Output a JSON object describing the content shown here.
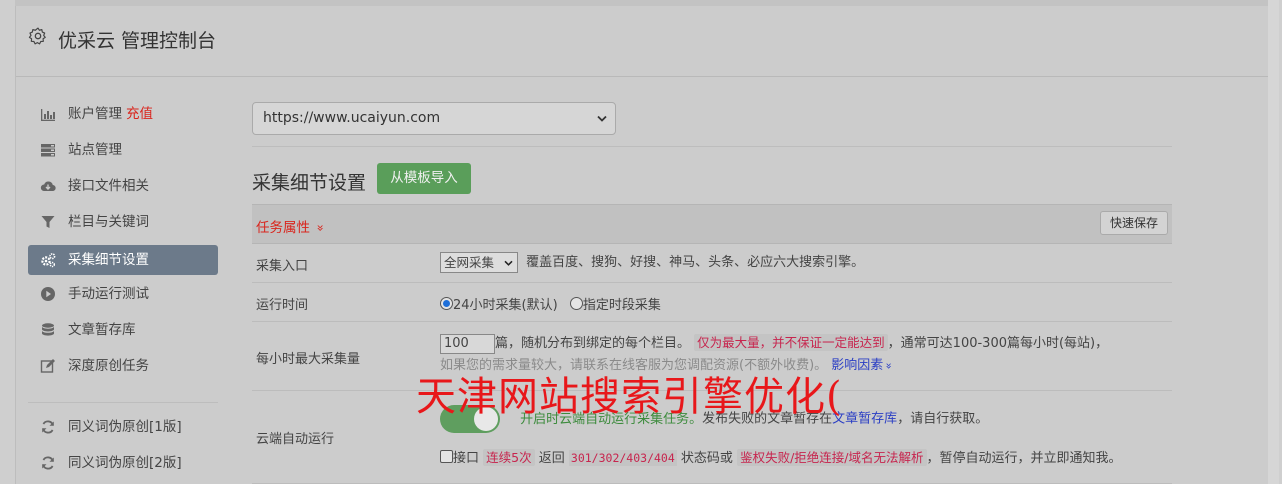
{
  "header": {
    "title": "优采云 管理控制台"
  },
  "sidebar": {
    "items": [
      {
        "label": "账户管理",
        "extra": "充值",
        "icon": "bar-chart-icon"
      },
      {
        "label": "站点管理",
        "icon": "server-icon"
      },
      {
        "label": "接口文件相关",
        "icon": "cloud-download-icon"
      },
      {
        "label": "栏目与关键词",
        "icon": "filter-icon"
      },
      {
        "label": "采集细节设置",
        "icon": "cogs-icon",
        "active": true
      },
      {
        "label": "手动运行测试",
        "icon": "play-circle-icon"
      },
      {
        "label": "文章暂存库",
        "icon": "database-icon"
      },
      {
        "label": "深度原创任务",
        "icon": "edit-icon"
      },
      {
        "label": "同义词伪原创[1版]",
        "icon": "refresh-icon"
      },
      {
        "label": "同义词伪原创[2版]",
        "icon": "refresh-icon"
      }
    ]
  },
  "main": {
    "site_select": {
      "value": "https://www.ucaiyun.com"
    },
    "section_title": "采集细节设置",
    "import_button": "从模板导入",
    "task_attr": "任务属性",
    "task_attr_chevron": "»",
    "quick_save": "快速保存",
    "rows": {
      "entry": {
        "label": "采集入口",
        "select_value": "全网采集",
        "desc": "覆盖百度、搜狗、好搜、神马、头条、必应六大搜索引擎。"
      },
      "time": {
        "label": "运行时间",
        "opt1": "24小时采集(默认)",
        "opt2": "指定时段采集"
      },
      "max": {
        "label": "每小时最大采集量",
        "input_value": "100",
        "text1": "篇，随机分布到绑定的每个栏目。",
        "warn": "仅为最大量，并不保证一定能达到",
        "text2": "，通常可达100-300篇每小时(每站)，",
        "line2_faded": "如果您的需求量较大，请联系在线客服为您调配资源(不额外收费)。",
        "factor_link": "影响因素",
        "factor_chevron": "»"
      },
      "cloud": {
        "label": "云端自动运行",
        "toggle_text": "开启时云端自动运行采集任务。",
        "text_a": "发布失败的文章暂存在",
        "link": "文章暂存库",
        "text_b": "，请自行获取。",
        "check_label": "接口",
        "tag1": "连续5次",
        "text_c": "返回",
        "codes": "301/302/403/404",
        "text_d": "状态码或",
        "tag2": "鉴权失败/拒绝连接/域名无法解析",
        "text_e": "，暂停自动运行，并立即通知我。"
      }
    }
  },
  "overlay": {
    "text": "天津网站搜索引擎优化("
  }
}
